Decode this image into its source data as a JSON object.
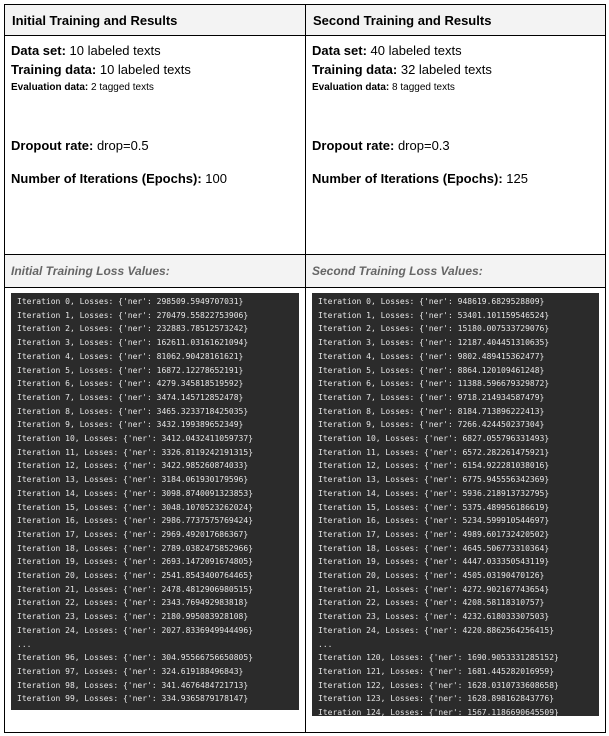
{
  "left": {
    "title": "Initial Training and Results",
    "dataset_label": "Data set:",
    "dataset_value": " 10 labeled texts",
    "training_label": "Training data:",
    "training_value": " 10 labeled texts",
    "eval_label": "Evaluation data:",
    "eval_value": " 2 tagged texts",
    "dropout_label": "Dropout rate:",
    "dropout_value": " drop=0.5",
    "iter_label": "Number of Iterations (Epochs):",
    "iter_value": " 100",
    "loss_title": "Initial Training Loss Values:",
    "log": [
      "Iteration 0, Losses: {'ner': 298509.5949707031}",
      "Iteration 1, Losses: {'ner': 270479.55822753906}",
      "Iteration 2, Losses: {'ner': 232883.78512573242}",
      "Iteration 3, Losses: {'ner': 162611.03161621094}",
      "Iteration 4, Losses: {'ner': 81062.90428161621}",
      "Iteration 5, Losses: {'ner': 16872.12278652191}",
      "Iteration 6, Losses: {'ner': 4279.345818519592}",
      "Iteration 7, Losses: {'ner': 3474.145712852478}",
      "Iteration 8, Losses: {'ner': 3465.3233718425035}",
      "Iteration 9, Losses: {'ner': 3432.199389652349}",
      "Iteration 10, Losses: {'ner': 3412.0432411059737}",
      "Iteration 11, Losses: {'ner': 3326.8119242191315}",
      "Iteration 12, Losses: {'ner': 3422.985260874033}",
      "Iteration 13, Losses: {'ner': 3184.061930179596}",
      "Iteration 14, Losses: {'ner': 3098.8740091323853}",
      "Iteration 15, Losses: {'ner': 3048.1070523262024}",
      "Iteration 16, Losses: {'ner': 2986.7737575769424}",
      "Iteration 17, Losses: {'ner': 2969.492017686367}",
      "Iteration 18, Losses: {'ner': 2789.0382475852966}",
      "Iteration 19, Losses: {'ner': 2693.1472091674805}",
      "Iteration 20, Losses: {'ner': 2541.8543400764465}",
      "Iteration 21, Losses: {'ner': 2478.4812906980515}",
      "Iteration 22, Losses: {'ner': 2343.769492983818}",
      "Iteration 23, Losses: {'ner': 2180.995083928108}",
      "Iteration 24, Losses: {'ner': 2027.8336949944496}",
      "...",
      "Iteration 96, Losses: {'ner': 304.95566756650805}",
      "Iteration 97, Losses: {'ner': 324.619188496843}",
      "Iteration 98, Losses: {'ner': 341.4676484721713}",
      "Iteration 99, Losses: {'ner': 334.9365879178147}"
    ]
  },
  "right": {
    "title": "Second Training and Results",
    "dataset_label": "Data set:",
    "dataset_value": " 40 labeled texts",
    "training_label": "Training data:",
    "training_value": " 32 labeled texts",
    "eval_label": "Evaluation data:",
    "eval_value": " 8 tagged texts",
    "dropout_label": "Dropout rate:",
    "dropout_value": " drop=0.3",
    "iter_label": "Number of Iterations (Epochs):",
    "iter_value": " 125",
    "loss_title": "Second Training Loss Values:",
    "log": [
      "Iteration 0, Losses: {'ner': 948619.6829528809}",
      "Iteration 1, Losses: {'ner': 53401.101159546524}",
      "Iteration 2, Losses: {'ner': 15180.007533729076}",
      "Iteration 3, Losses: {'ner': 12187.404451310635}",
      "Iteration 4, Losses: {'ner': 9802.489415362477}",
      "Iteration 5, Losses: {'ner': 8864.120109461248}",
      "Iteration 6, Losses: {'ner': 11388.596679329872}",
      "Iteration 7, Losses: {'ner': 9718.214934587479}",
      "Iteration 8, Losses: {'ner': 8184.713896222413}",
      "Iteration 9, Losses: {'ner': 7266.424450237304}",
      "Iteration 10, Losses: {'ner': 6827.055796331493}",
      "Iteration 11, Losses: {'ner': 6572.282261475921}",
      "Iteration 12, Losses: {'ner': 6154.922281038016}",
      "Iteration 13, Losses: {'ner': 6775.945556342369}",
      "Iteration 14, Losses: {'ner': 5936.218913732795}",
      "Iteration 15, Losses: {'ner': 5375.489956186619}",
      "Iteration 16, Losses: {'ner': 5234.599910544697}",
      "Iteration 17, Losses: {'ner': 4989.601732420502}",
      "Iteration 18, Losses: {'ner': 4645.506773310364}",
      "Iteration 19, Losses: {'ner': 4447.033350543119}",
      "Iteration 20, Losses: {'ner': 4505.03190470126}",
      "Iteration 21, Losses: {'ner': 4272.902167743654}",
      "Iteration 22, Losses: {'ner': 4208.58118310757}",
      "Iteration 23, Losses: {'ner': 4232.618033307503}",
      "Iteration 24, Losses: {'ner': 4220.8862564256415}",
      "...",
      "Iteration 120, Losses: {'ner': 1690.9053331285152}",
      "Iteration 121, Losses: {'ner': 1681.445282016959}",
      "Iteration 122, Losses: {'ner': 1628.0310733608658}",
      "Iteration 123, Losses: {'ner': 1628.898162843776}",
      "Iteration 124, Losses: {'ner': 1567.1186690645509}"
    ]
  }
}
